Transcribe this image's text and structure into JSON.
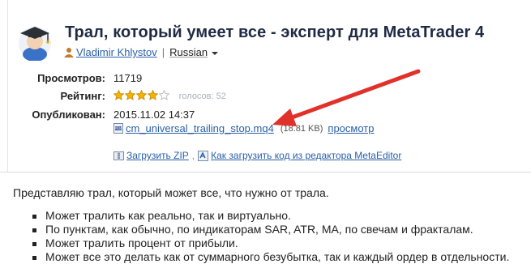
{
  "header": {
    "title": "Трал, который умеет все - эксперт для MetaTrader 4",
    "author": "Vladimir Khlystov",
    "separator": "|",
    "language": "Russian"
  },
  "meta": {
    "views_label": "Просмотров:",
    "views_value": "11719",
    "rating_label": "Рейтинг:",
    "rating_stars": 4,
    "rating_max": 5,
    "votes_text": "голосов: 52",
    "published_label": "Опубликован:",
    "published_value": "2015.11.02 14:37"
  },
  "file": {
    "name": "cm_universal_trailing_stop.mq4",
    "size": "(18.81 KB)",
    "view_label": "просмотр"
  },
  "actions": {
    "download_zip": "Загрузить ZIP",
    "separator": ",",
    "metaeditor_link": "Как загрузить код из редактора MetaEditor"
  },
  "colors": {
    "link": "#2a5fa8",
    "arrow": "#e0312b",
    "star": "#f5b400"
  },
  "content": {
    "intro": "Представляю трал, который может все, что нужно от трала.",
    "bullets": [
      "Может тралить как реально, так и виртуально.",
      "По пунктам, как обычно, по индикаторам SAR, ATR, MA, по свечам и фракталам.",
      "Может тралить процент от прибыли.",
      "Может все это делать как от суммарного безубытка, так и каждый ордер в отдельности."
    ]
  }
}
